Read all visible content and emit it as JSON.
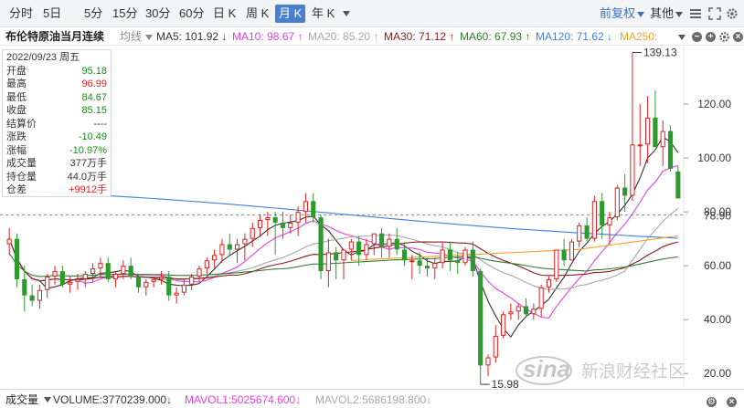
{
  "toolbar": {
    "tabs": [
      "分时",
      "5日",
      "5分",
      "15分",
      "30分",
      "60分",
      "日 K",
      "周 K",
      "月 K",
      "年 K"
    ],
    "active_tab": "月 K",
    "adjust_label": "前复权",
    "other_label": "其他"
  },
  "ma_bar": {
    "instrument": "布伦特原油当月连续",
    "mode_label": "均线",
    "items": [
      {
        "label": "MA5: 101.92",
        "arrow": "↓",
        "color": "#333333"
      },
      {
        "label": "MA10: 98.67",
        "arrow": "↑",
        "color": "#e442e4"
      },
      {
        "label": "MA20: 85.20",
        "arrow": "↑",
        "color": "#a8a8a8"
      },
      {
        "label": "MA30: 71.12",
        "arrow": "↑",
        "color": "#8b1a1a"
      },
      {
        "label": "MA60: 67.93",
        "arrow": "↑",
        "color": "#2e7d32"
      },
      {
        "label": "MA120: 71.62",
        "arrow": "↓",
        "color": "#3f7fd9"
      },
      {
        "label": "MA250:",
        "arrow": "",
        "color": "#f0a030"
      }
    ]
  },
  "info_panel": {
    "date": "2022/09/23 周五",
    "rows": [
      {
        "label": "开盘",
        "value": "95.18",
        "color": "#1a8c1a"
      },
      {
        "label": "最高",
        "value": "96.99",
        "color": "#e02020"
      },
      {
        "label": "最低",
        "value": "84.67",
        "color": "#1a8c1a"
      },
      {
        "label": "收盘",
        "value": "85.15",
        "color": "#1a8c1a"
      },
      {
        "label": "结算价",
        "value": "----",
        "color": "#333333"
      },
      {
        "label": "涨跌",
        "value": "-10.49",
        "color": "#1a8c1a"
      },
      {
        "label": "涨幅",
        "value": "-10.97%",
        "color": "#1a8c1a"
      },
      {
        "label": "成交量",
        "value": "377万手",
        "color": "#333333"
      },
      {
        "label": "持仓量",
        "value": "44.0万手",
        "color": "#333333"
      },
      {
        "label": "仓差",
        "value": "+9912手",
        "color": "#e02020"
      }
    ]
  },
  "price_axis": {
    "ticks": [
      "120.00",
      "100.00",
      "80.00",
      "60.00",
      "40.00",
      "20.00"
    ],
    "current_price": "78.90",
    "high_marker": "139.13",
    "low_marker": "15.98"
  },
  "volume_bar": {
    "label": "成交量",
    "items": [
      {
        "label": "VOLUME:3770239.000",
        "arrow": "↓",
        "color": "#333333"
      },
      {
        "label": "MAVOL1:5025674.600",
        "arrow": "↓",
        "color": "#e442e4"
      },
      {
        "label": "MAVOL2:5686198.800",
        "arrow": "↓",
        "color": "#a8a8a8"
      }
    ]
  },
  "watermark": {
    "brand": "sina",
    "text": "新浪财经社区"
  },
  "colors": {
    "up": "#e02020",
    "down": "#2e9a2e",
    "accent": "#4a7fd0"
  },
  "chart_data": {
    "type": "candlestick",
    "period": "monthly",
    "y_axis": {
      "min": 15,
      "max": 140,
      "ticks": [
        20,
        40,
        60,
        80,
        100,
        120
      ]
    },
    "candles": [
      [
        68,
        74,
        64,
        70
      ],
      [
        70,
        72,
        52,
        55
      ],
      [
        55,
        60,
        43,
        49
      ],
      [
        49,
        53,
        45,
        47
      ],
      [
        47,
        53,
        44,
        51
      ],
      [
        51,
        57,
        48,
        56
      ],
      [
        56,
        60,
        53,
        58
      ],
      [
        58,
        60,
        52,
        53
      ],
      [
        53,
        56,
        50,
        54
      ],
      [
        54,
        57,
        51,
        55
      ],
      [
        55,
        58,
        52,
        57
      ],
      [
        57,
        61,
        54,
        59
      ],
      [
        59,
        63,
        56,
        61
      ],
      [
        61,
        63,
        54,
        55
      ],
      [
        55,
        58,
        52,
        57
      ],
      [
        57,
        62,
        55,
        60
      ],
      [
        60,
        63,
        55,
        56
      ],
      [
        56,
        57,
        50,
        52
      ],
      [
        52,
        55,
        49,
        54
      ],
      [
        54,
        56,
        52,
        55
      ],
      [
        55,
        58,
        53,
        56
      ],
      [
        56,
        58,
        47,
        49
      ],
      [
        49,
        52,
        46,
        50
      ],
      [
        50,
        55,
        49,
        53
      ],
      [
        53,
        57,
        51,
        56
      ],
      [
        56,
        60,
        54,
        59
      ],
      [
        59,
        63,
        57,
        62
      ],
      [
        62,
        66,
        59,
        64
      ],
      [
        64,
        70,
        61,
        68
      ],
      [
        68,
        72,
        64,
        66
      ],
      [
        66,
        70,
        61,
        68
      ],
      [
        68,
        72,
        62,
        70
      ],
      [
        70,
        76,
        67,
        74
      ],
      [
        74,
        79,
        71,
        77
      ],
      [
        77,
        80,
        71,
        78
      ],
      [
        78,
        80,
        64,
        76
      ],
      [
        76,
        80,
        70,
        74
      ],
      [
        74,
        79,
        72,
        76
      ],
      [
        76,
        82,
        71,
        80
      ],
      [
        80,
        87,
        76,
        84
      ],
      [
        84,
        87,
        76,
        78
      ],
      [
        78,
        79,
        55,
        58
      ],
      [
        58,
        70,
        52,
        65
      ],
      [
        65,
        67,
        55,
        62
      ],
      [
        62,
        66,
        55,
        66
      ],
      [
        66,
        70,
        62,
        69
      ],
      [
        69,
        71,
        60,
        64
      ],
      [
        64,
        70,
        62,
        68
      ],
      [
        68,
        72,
        64,
        72
      ],
      [
        72,
        74,
        63,
        67
      ],
      [
        67,
        72,
        63,
        70
      ],
      [
        70,
        74,
        64,
        66
      ],
      [
        66,
        68,
        60,
        62
      ],
      [
        62,
        64,
        55,
        62
      ],
      [
        62,
        65,
        57,
        60
      ],
      [
        60,
        63,
        56,
        59
      ],
      [
        59,
        63,
        55,
        61
      ],
      [
        61,
        69,
        59,
        66
      ],
      [
        66,
        69,
        58,
        62
      ],
      [
        62,
        65,
        57,
        61
      ],
      [
        61,
        67,
        60,
        66
      ],
      [
        66,
        69,
        56,
        58
      ],
      [
        58,
        59,
        16,
        23
      ],
      [
        23,
        27,
        19,
        26
      ],
      [
        26,
        38,
        24,
        34
      ],
      [
        34,
        43,
        33,
        42
      ],
      [
        42,
        46,
        40,
        43
      ],
      [
        43,
        46,
        40,
        45
      ],
      [
        45,
        48,
        41,
        42
      ],
      [
        42,
        46,
        40,
        44
      ],
      [
        44,
        53,
        41,
        52
      ],
      [
        52,
        56,
        50,
        55
      ],
      [
        55,
        66,
        54,
        66
      ],
      [
        66,
        70,
        60,
        62
      ],
      [
        62,
        70,
        62,
        69
      ],
      [
        69,
        76,
        67,
        75
      ],
      [
        75,
        78,
        69,
        70
      ],
      [
        70,
        86,
        69,
        84
      ],
      [
        84,
        87,
        70,
        75
      ],
      [
        75,
        80,
        68,
        78
      ],
      [
        78,
        90,
        77,
        89
      ],
      [
        89,
        94,
        80,
        86
      ],
      [
        86,
        139,
        84,
        105
      ],
      [
        105,
        120,
        97,
        105
      ],
      [
        105,
        123,
        98,
        115
      ],
      [
        115,
        125,
        105,
        104
      ],
      [
        104,
        114,
        97,
        110
      ],
      [
        110,
        112,
        95,
        96
      ],
      [
        95,
        97,
        85,
        85
      ]
    ],
    "moving_averages": [
      {
        "name": "MA5",
        "color": "#333333",
        "last": 101.92
      },
      {
        "name": "MA10",
        "color": "#e442e4",
        "last": 98.67
      },
      {
        "name": "MA20",
        "color": "#a8a8a8",
        "last": 85.2
      },
      {
        "name": "MA30",
        "color": "#8b1a1a",
        "last": 71.12
      },
      {
        "name": "MA60",
        "color": "#2e7d32",
        "last": 67.93
      },
      {
        "name": "MA120",
        "color": "#3f7fd9",
        "last": 71.62
      }
    ],
    "high_value": 139.13,
    "low_value": 15.98,
    "reference_price": 78.9
  }
}
